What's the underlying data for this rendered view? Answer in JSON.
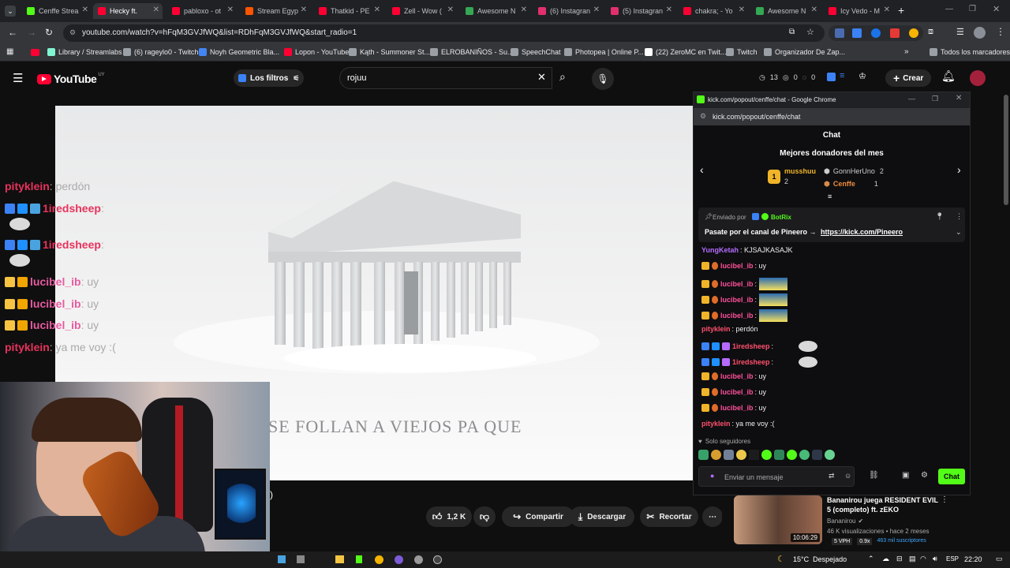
{
  "tabs": [
    {
      "label": "Cenffe Strea",
      "color": "#53fc18"
    },
    {
      "label": "Hecky ft.",
      "color": "#ff0033",
      "active": true
    },
    {
      "label": "pabloxo - ot",
      "color": "#ff0033"
    },
    {
      "label": "Stream Egyp",
      "color": "#ff5500"
    },
    {
      "label": "Thatkid - PE",
      "color": "#ff0033"
    },
    {
      "label": "Zell - Wow (",
      "color": "#ff0033"
    },
    {
      "label": "Awesome N",
      "color": "#34a853"
    },
    {
      "label": "(6) Instagran",
      "color": "#e1306c"
    },
    {
      "label": "(5) Instagran",
      "color": "#e1306c"
    },
    {
      "label": "chakra; - Yo",
      "color": "#ff0033"
    },
    {
      "label": "Awesome N",
      "color": "#34a853"
    },
    {
      "label": "Icy Vedo - M",
      "color": "#ff0033"
    }
  ],
  "address": {
    "url": "youtube.com/watch?v=hFqM3GVJfWQ&list=RDhFqM3GVJfWQ&start_radio=1"
  },
  "bookmarks": [
    {
      "label": "Library / Streamlabs",
      "color": "#80f5d2"
    },
    {
      "label": "(6) rageylo0 - Twitch",
      "color": "#9aa0a6"
    },
    {
      "label": "Noyh Geometric Bla...",
      "color": "#4285f4"
    },
    {
      "label": "Lopon - YouTube",
      "color": "#ff0033"
    },
    {
      "label": "Kąth - Summoner St...",
      "color": "#9aa0a6"
    },
    {
      "label": "ELROBANIÑOS - Su...",
      "color": "#9aa0a6"
    },
    {
      "label": "SpeechChat",
      "color": "#9aa0a6"
    },
    {
      "label": "Photopea | Online P...",
      "color": "#9aa0a6"
    },
    {
      "label": "(22) ZeroMC en Twit...",
      "color": "#ffffff"
    },
    {
      "label": "Twitch",
      "color": "#9aa0a6"
    },
    {
      "label": "Organizador De Zap...",
      "color": "#9aa0a6"
    }
  ],
  "bookmarks_all": "Todos los marcadores",
  "youtube": {
    "logo": "YouTube",
    "region": "UY",
    "filters": "Los filtros",
    "search_value": "rojuu",
    "counters": [
      "13",
      "0",
      "0"
    ],
    "create": "Crear",
    "subtitle": "SE FOLLAN A VIEJOS PA QUE",
    "likes": "1,2 K",
    "share": "Compartir",
    "download": "Descargar",
    "clip": "Recortar"
  },
  "overlay_chat": [
    {
      "user": "pityklein",
      "text": ": perdón",
      "color": "#e8325c"
    },
    {
      "user": "1iredsheep",
      "text": " :",
      "color": "#e8325c",
      "emote": true
    },
    {
      "user": "1iredsheep",
      "text": " :",
      "color": "#e8325c",
      "emote": true
    },
    {
      "user": "lucibel_ib",
      "text": " : uy",
      "color": "#e85aa0"
    },
    {
      "user": "lucibel_ib",
      "text": " : uy",
      "color": "#e85aa0"
    },
    {
      "user": "lucibel_ib",
      "text": " : uy",
      "color": "#e85aa0"
    },
    {
      "user": "pityklein",
      "text": " : ya me voy :(",
      "color": "#e8325c"
    }
  ],
  "chat_window": {
    "titlebar": "kick.com/popout/cenffe/chat - Google Chrome",
    "url": "kick.com/popout/cenffe/chat",
    "title": "Chat",
    "donors_title": "Mejores donadores del mes",
    "donors": [
      {
        "name": "musshuu",
        "count": "2"
      },
      {
        "name": "GonnHerUno",
        "count": "2"
      },
      {
        "name": "Cenffe",
        "count": "1"
      }
    ],
    "pinned_by_label": "Enviado por",
    "pinned_by": "BotRix",
    "pinned_text": "Pasate por el canal de Pineero →",
    "pinned_link": "https://kick.com/Pineero",
    "messages": [
      {
        "user": "YungKetah",
        "text": ": KJSAJKASAJK",
        "color": "#b56bff"
      },
      {
        "user": "lucibel_ib",
        "text": ": uy",
        "color": "#ff4f9a"
      },
      {
        "user": "lucibel_ib",
        "text": ":",
        "color": "#ff4f9a",
        "emote": true
      },
      {
        "user": "lucibel_ib",
        "text": ":",
        "color": "#ff4f9a",
        "emote": true
      },
      {
        "user": "lucibel_ib",
        "text": ":",
        "color": "#ff4f9a",
        "emote": true
      },
      {
        "user": "pityklein",
        "text": ": perdón",
        "color": "#ff4f6d"
      },
      {
        "user": "1iredsheep",
        "text": ":",
        "color": "#ff4f6d",
        "emote": true
      },
      {
        "user": "1iredsheep",
        "text": ":",
        "color": "#ff4f6d",
        "emote": true
      },
      {
        "user": "lucibel_ib",
        "text": ": uy",
        "color": "#ff4f9a"
      },
      {
        "user": "lucibel_ib",
        "text": ": uy",
        "color": "#ff4f9a"
      },
      {
        "user": "lucibel_ib",
        "text": ": uy",
        "color": "#ff4f9a"
      },
      {
        "user": "pityklein",
        "text": ": ya me voy :(",
        "color": "#ff4f6d"
      }
    ],
    "followers_only": "Solo seguidores",
    "input_placeholder": "Enviar un mensaje",
    "send": "Chat"
  },
  "recommended": {
    "title": "Bananirou juega RESIDENT EVIL 5 (completo) ft. zEKO",
    "channel": "Bananirou",
    "stats": "46 K visualizaciones • hace 2 meses",
    "duration": "10:06:29",
    "vph": "5 VPH",
    "ratio": "0.9x",
    "subs": "463 mil suscriptores"
  },
  "taskbar": {
    "weather": "15°C  Despejado",
    "lang": "ESP",
    "time": "22:20"
  }
}
